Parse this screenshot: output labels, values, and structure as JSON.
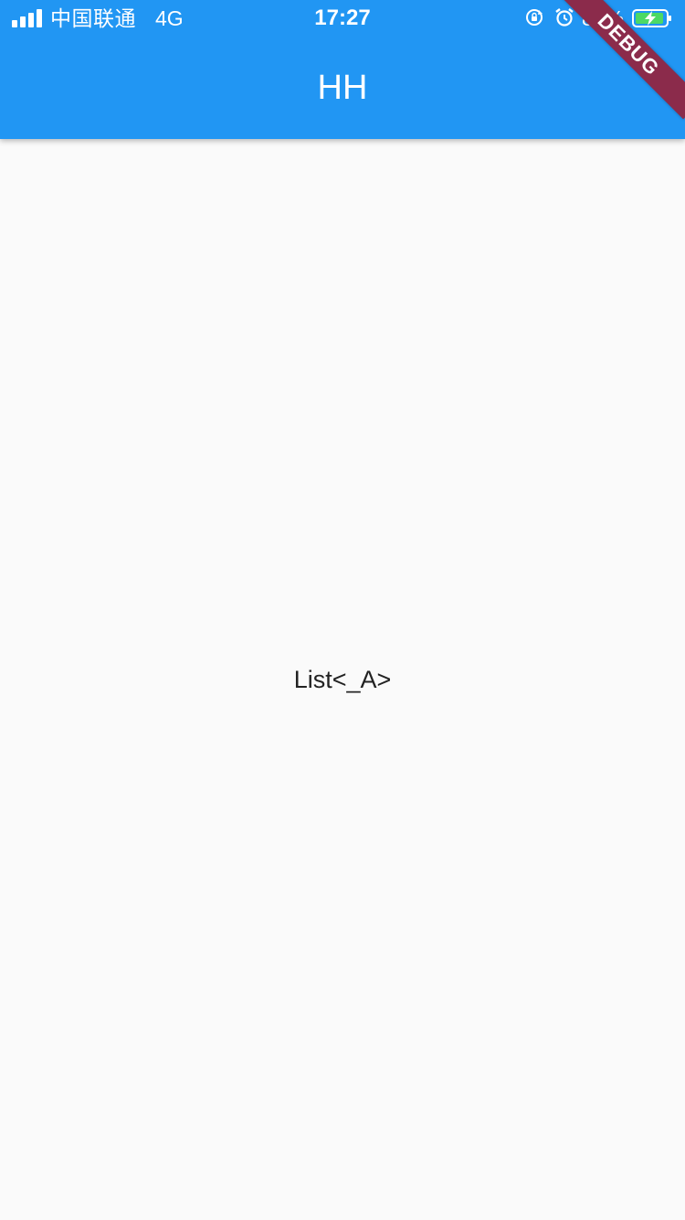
{
  "status_bar": {
    "carrier": "中国联通",
    "network": "4G",
    "time": "17:27",
    "battery_percent": "86%",
    "icons": [
      "signal-icon",
      "rotation-lock-icon",
      "alarm-icon",
      "battery-charging-icon"
    ]
  },
  "app_bar": {
    "title": "HH"
  },
  "body": {
    "text": "List<_A>"
  },
  "debug_banner": {
    "label": "DEBUG"
  },
  "colors": {
    "app_bar": "#2196f3",
    "background": "#fafafa",
    "debug_banner": "#8b2b4b",
    "battery_fill": "#4cd964"
  }
}
